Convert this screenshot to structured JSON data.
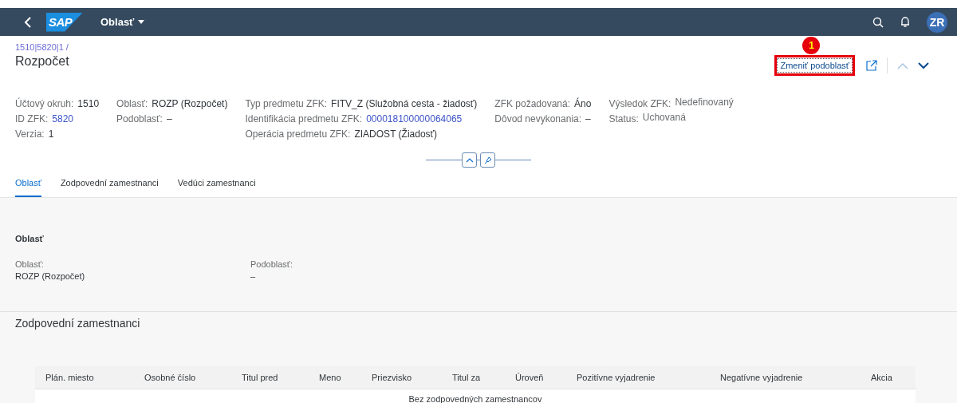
{
  "shell": {
    "logo_text": "SAP",
    "app_title": "Oblasť",
    "avatar": "ZR"
  },
  "breadcrumb": "1510|5820|1 /",
  "title": "Rozpočet",
  "actions": [
    {
      "label": "Zmeniť podoblasť",
      "highlighted": true,
      "badge": "1"
    }
  ],
  "attribute_columns": [
    [
      {
        "label": "Účtový okruh:",
        "value": "1510",
        "kind": "text"
      },
      {
        "label": "ID ZFK:",
        "value": "5820",
        "kind": "link"
      },
      {
        "label": "Verzia:",
        "value": "1",
        "kind": "text"
      }
    ],
    [
      {
        "label": "Oblasť:",
        "value": "ROZP (Rozpočet)",
        "kind": "text"
      },
      {
        "label": "Podoblasť:",
        "value": "–",
        "kind": "text"
      }
    ],
    [
      {
        "label": "Typ predmetu ZFK:",
        "value": "FITV_Z (Služobná cesta - žiadosť)",
        "kind": "text"
      },
      {
        "label": "Identifikácia predmetu ZFK:",
        "value": "000018100000064065",
        "kind": "link"
      },
      {
        "label": "Operácia predmetu ZFK:",
        "value": "ZIADOST (Žiadosť)",
        "kind": "text"
      }
    ],
    [
      {
        "label": "ZFK požadovaná:",
        "value": "Áno",
        "kind": "text"
      },
      {
        "label": "Dôvod nevykonania:",
        "value": "–",
        "kind": "text"
      }
    ],
    [
      {
        "label": "Výsledok ZFK:",
        "value": "Nedefinovaný",
        "kind": "status"
      },
      {
        "label": "Status:",
        "value": "Uchovaná",
        "kind": "status"
      }
    ]
  ],
  "tabs": [
    {
      "label": "Oblasť",
      "selected": true
    },
    {
      "label": "Zodpovední zamestnanci",
      "selected": false
    },
    {
      "label": "Vedúci zamestnanci",
      "selected": false
    }
  ],
  "section_oblast": {
    "title": "Oblasť",
    "fields": [
      {
        "label": "Oblasť:",
        "value": "ROZP (Rozpočet)"
      },
      {
        "label": "Podoblasť:",
        "value": "–"
      }
    ]
  },
  "section_employees": {
    "title": "Zodpovední zamestnanci",
    "table": {
      "columns": [
        "Plán. miesto",
        "Osobné číslo",
        "Titul pred",
        "Meno",
        "Priezvisko",
        "Titul za",
        "Úroveň",
        "Pozitívne vyjadrenie",
        "Negatívne vyjadrenie",
        "Akcia"
      ],
      "no_data": "Bez zodpovedných zamestnancov"
    }
  }
}
